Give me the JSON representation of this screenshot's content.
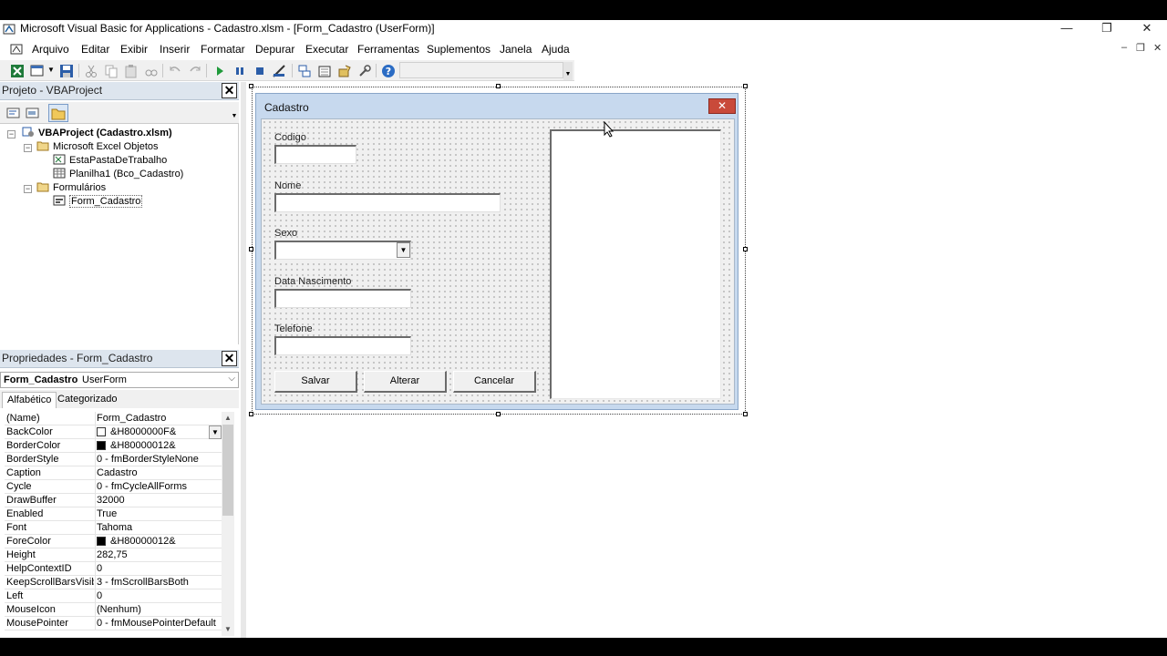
{
  "window": {
    "title": "Microsoft Visual Basic for Applications - Cadastro.xlsm - [Form_Cadastro (UserForm)]",
    "minimize_glyph": "—",
    "restore_glyph": "❐",
    "close_glyph": "✕"
  },
  "menu": {
    "items": [
      "Arquivo",
      "Editar",
      "Exibir",
      "Inserir",
      "Formatar",
      "Depurar",
      "Executar",
      "Ferramentas",
      "Suplementos",
      "Janela",
      "Ajuda"
    ],
    "mdi_min": "‒",
    "mdi_restore": "❐",
    "mdi_close": "✕"
  },
  "project": {
    "title": "Projeto - VBAProject",
    "close": "✕",
    "tree": {
      "root": "VBAProject (Cadastro.xlsm)",
      "excel_objects": "Microsoft Excel Objetos",
      "workbook": "EstaPastaDeTrabalho",
      "sheet": "Planilha1 (Bco_Cadastro)",
      "forms": "Formulários",
      "form": "Form_Cadastro"
    }
  },
  "properties": {
    "title": "Propriedades - Form_Cadastro",
    "close": "✕",
    "object_name": "Form_Cadastro",
    "object_type": "UserForm",
    "tabs": [
      "Alfabético",
      "Categorizado"
    ],
    "rows": [
      {
        "name": "(Name)",
        "value": "Form_Cadastro"
      },
      {
        "name": "BackColor",
        "value": "&H8000000F&",
        "swatch": "#ffffff"
      },
      {
        "name": "BorderColor",
        "value": "&H80000012&",
        "swatch": "#000000"
      },
      {
        "name": "BorderStyle",
        "value": "0 - fmBorderStyleNone"
      },
      {
        "name": "Caption",
        "value": "Cadastro"
      },
      {
        "name": "Cycle",
        "value": "0 - fmCycleAllForms"
      },
      {
        "name": "DrawBuffer",
        "value": "32000"
      },
      {
        "name": "Enabled",
        "value": "True"
      },
      {
        "name": "Font",
        "value": "Tahoma"
      },
      {
        "name": "ForeColor",
        "value": "&H80000012&",
        "swatch": "#000000"
      },
      {
        "name": "Height",
        "value": "282,75"
      },
      {
        "name": "HelpContextID",
        "value": "0"
      },
      {
        "name": "KeepScrollBarsVisible",
        "value": "3 - fmScrollBarsBoth"
      },
      {
        "name": "Left",
        "value": "0"
      },
      {
        "name": "MouseIcon",
        "value": "(Nenhum)"
      },
      {
        "name": "MousePointer",
        "value": "0 - fmMousePointerDefault"
      }
    ]
  },
  "userform": {
    "caption": "Cadastro",
    "close": "✕",
    "labels": {
      "codigo": "Codigo",
      "nome": "Nome",
      "sexo": "Sexo",
      "data_nascimento": "Data Nascimento",
      "telefone": "Telefone"
    },
    "buttons": {
      "salvar": "Salvar",
      "alterar": "Alterar",
      "cancelar": "Cancelar"
    }
  },
  "colors": {
    "form_titlebar": "#c7d9ee",
    "close_red": "#c94a3a",
    "panel_header": "#dde5ee"
  }
}
